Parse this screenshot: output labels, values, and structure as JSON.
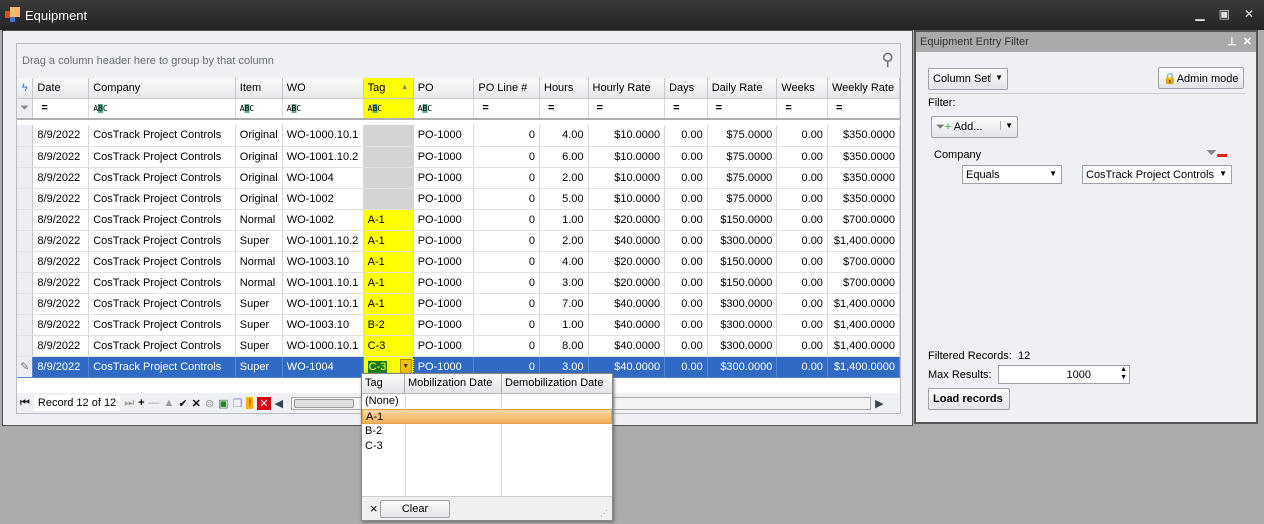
{
  "window": {
    "title": "Equipment"
  },
  "grid": {
    "group_hint": "Drag a column header here to group by that column",
    "columns": [
      "Date",
      "Company",
      "Item",
      "WO",
      "Tag",
      "PO",
      "PO Line #",
      "Hours",
      "Hourly Rate",
      "Days",
      "Daily Rate",
      "Weeks",
      "Weekly Rate"
    ],
    "sorted_column": "Tag",
    "filter_row": [
      "=",
      "ABC",
      "ABC",
      "ABC",
      "ABC",
      "ABC",
      "=",
      "=",
      "=",
      "=",
      "=",
      "=",
      "="
    ],
    "rows": [
      [
        "8/9/2022",
        "CosTrack Project Controls",
        "Original",
        "WO-1000.10.1",
        "",
        "PO-1000",
        "0",
        "4.00",
        "$10.0000",
        "0.00",
        "$75.0000",
        "0.00",
        "$350.0000"
      ],
      [
        "8/9/2022",
        "CosTrack Project Controls",
        "Original",
        "WO-1001.10.2",
        "",
        "PO-1000",
        "0",
        "6.00",
        "$10.0000",
        "0.00",
        "$75.0000",
        "0.00",
        "$350.0000"
      ],
      [
        "8/9/2022",
        "CosTrack Project Controls",
        "Original",
        "WO-1004",
        "",
        "PO-1000",
        "0",
        "2.00",
        "$10.0000",
        "0.00",
        "$75.0000",
        "0.00",
        "$350.0000"
      ],
      [
        "8/9/2022",
        "CosTrack Project Controls",
        "Original",
        "WO-1002",
        "",
        "PO-1000",
        "0",
        "5.00",
        "$10.0000",
        "0.00",
        "$75.0000",
        "0.00",
        "$350.0000"
      ],
      [
        "8/9/2022",
        "CosTrack Project Controls",
        "Normal",
        "WO-1002",
        "A-1",
        "PO-1000",
        "0",
        "1.00",
        "$20.0000",
        "0.00",
        "$150.0000",
        "0.00",
        "$700.0000"
      ],
      [
        "8/9/2022",
        "CosTrack Project Controls",
        "Super",
        "WO-1001.10.2",
        "A-1",
        "PO-1000",
        "0",
        "2.00",
        "$40.0000",
        "0.00",
        "$300.0000",
        "0.00",
        "$1,400.0000"
      ],
      [
        "8/9/2022",
        "CosTrack Project Controls",
        "Normal",
        "WO-1003.10",
        "A-1",
        "PO-1000",
        "0",
        "4.00",
        "$20.0000",
        "0.00",
        "$150.0000",
        "0.00",
        "$700.0000"
      ],
      [
        "8/9/2022",
        "CosTrack Project Controls",
        "Normal",
        "WO-1001.10.1",
        "A-1",
        "PO-1000",
        "0",
        "3.00",
        "$20.0000",
        "0.00",
        "$150.0000",
        "0.00",
        "$700.0000"
      ],
      [
        "8/9/2022",
        "CosTrack Project Controls",
        "Super",
        "WO-1001.10.1",
        "A-1",
        "PO-1000",
        "0",
        "7.00",
        "$40.0000",
        "0.00",
        "$300.0000",
        "0.00",
        "$1,400.0000"
      ],
      [
        "8/9/2022",
        "CosTrack Project Controls",
        "Super",
        "WO-1003.10",
        "B-2",
        "PO-1000",
        "0",
        "1.00",
        "$40.0000",
        "0.00",
        "$300.0000",
        "0.00",
        "$1,400.0000"
      ],
      [
        "8/9/2022",
        "CosTrack Project Controls",
        "Super",
        "WO-1000.10.1",
        "C-3",
        "PO-1000",
        "0",
        "8.00",
        "$40.0000",
        "0.00",
        "$300.0000",
        "0.00",
        "$1,400.0000"
      ],
      [
        "8/9/2022",
        "CosTrack Project Controls",
        "Super",
        "WO-1004",
        "C-3",
        "PO-1000",
        "0",
        "3.00",
        "$40.0000",
        "0.00",
        "$300.0000",
        "0.00",
        "$1,400.0000"
      ]
    ],
    "selected_row": 12,
    "record_label": "Record 12 of 12"
  },
  "tag_dropdown": {
    "columns": [
      "Tag",
      "Mobilization Date",
      "Demobilization Date"
    ],
    "items": [
      "(None)",
      "A-1",
      "B-2",
      "C-3"
    ],
    "highlighted": "A-1",
    "clear_label": "Clear",
    "close_glyph": "×"
  },
  "filter_panel": {
    "title": "Equipment Entry Filter",
    "column_set_label": "Column Set",
    "admin_mode_label": "Admin mode",
    "filter_label": "Filter:",
    "add_label": "Add...",
    "field": "Company",
    "operator": "Equals",
    "value": "CosTrack Project Controls",
    "filtered_records_label": "Filtered Records:",
    "filtered_records": "12",
    "max_results_label": "Max Results:",
    "max_results": "1000",
    "load_label": "Load records"
  },
  "colors": {
    "tag_highlight": "#ffff00",
    "selection": "#316ac5",
    "dropdown_highlight": "#f5ae56"
  }
}
